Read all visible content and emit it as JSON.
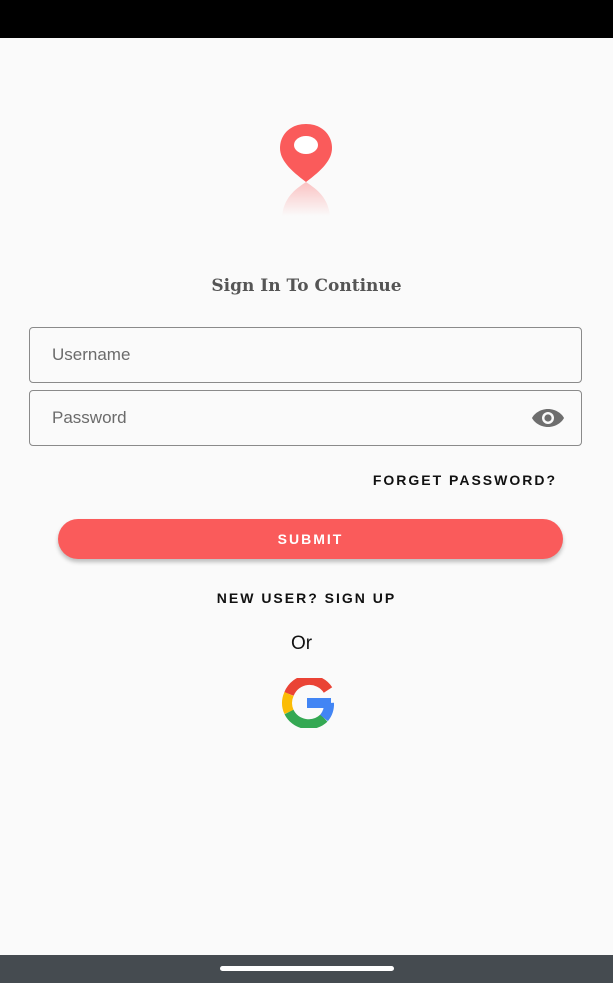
{
  "app": {
    "title": "Sign In To Continue"
  },
  "form": {
    "username_placeholder": "Username",
    "username_value": "",
    "password_placeholder": "Password",
    "password_value": "",
    "forgot_label": "FORGET PASSWORD?",
    "submit_label": "SUBMIT",
    "signup_label": "NEW USER? SIGN UP",
    "or_label": "Or"
  },
  "icons": {
    "logo": "location-pin-icon",
    "password_toggle": "eye-icon",
    "google": "google-icon"
  },
  "colors": {
    "accent": "#fa5b5b",
    "background": "#fafafa",
    "status_bar": "#000000",
    "nav_bar": "#454b50"
  }
}
